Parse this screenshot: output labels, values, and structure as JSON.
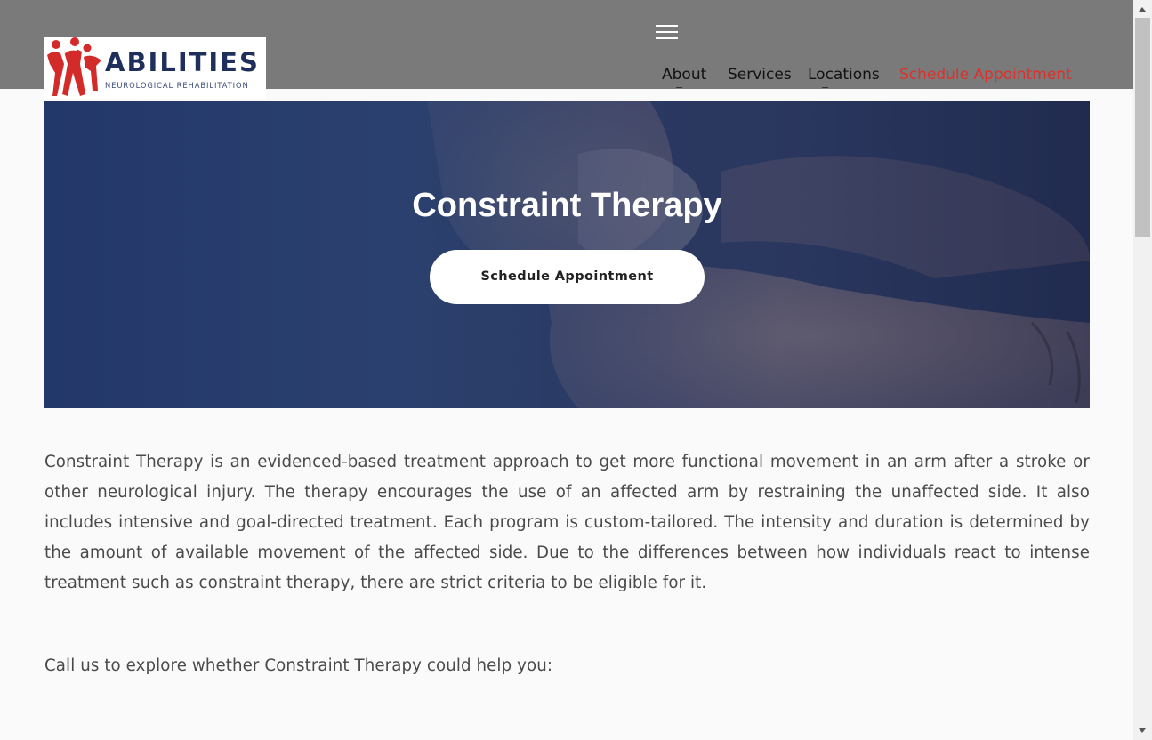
{
  "brand": {
    "name": "ABILITIES",
    "tagline": "NEUROLOGICAL REHABILITATION",
    "colors": {
      "navy": "#1f2f5c",
      "red": "#d32a2a"
    }
  },
  "header": {
    "menu_icon": "hamburger-menu-icon",
    "nav": {
      "about": "About",
      "services": "Services",
      "locations": "Locations",
      "schedule": "Schedule Appointment"
    },
    "colors": {
      "background": "#7a7a7a",
      "cta": "#e0302a"
    }
  },
  "hero": {
    "title": "Constraint Therapy",
    "button_label": "Schedule Appointment",
    "overlay_color": "#23386a"
  },
  "content": {
    "paragraph1": "Constraint Therapy is an evidenced-based treatment approach to get more functional movement in an arm after a stroke or other neurological injury. The therapy encourages the use of an affected arm by restraining the unaffected side. It also includes intensive and goal-directed treatment. Each program is custom-tailored. The intensity and duration is determined by the amount of available movement of the affected side. Due to the differences between how individuals react to intense treatment such as constraint therapy, there are strict criteria to be eligible for it.",
    "paragraph2": "Call us to explore whether Constraint Therapy could help you:"
  },
  "scrollbar": {
    "up_icon": "scroll-up-arrow-icon",
    "down_icon": "scroll-down-arrow-icon"
  }
}
